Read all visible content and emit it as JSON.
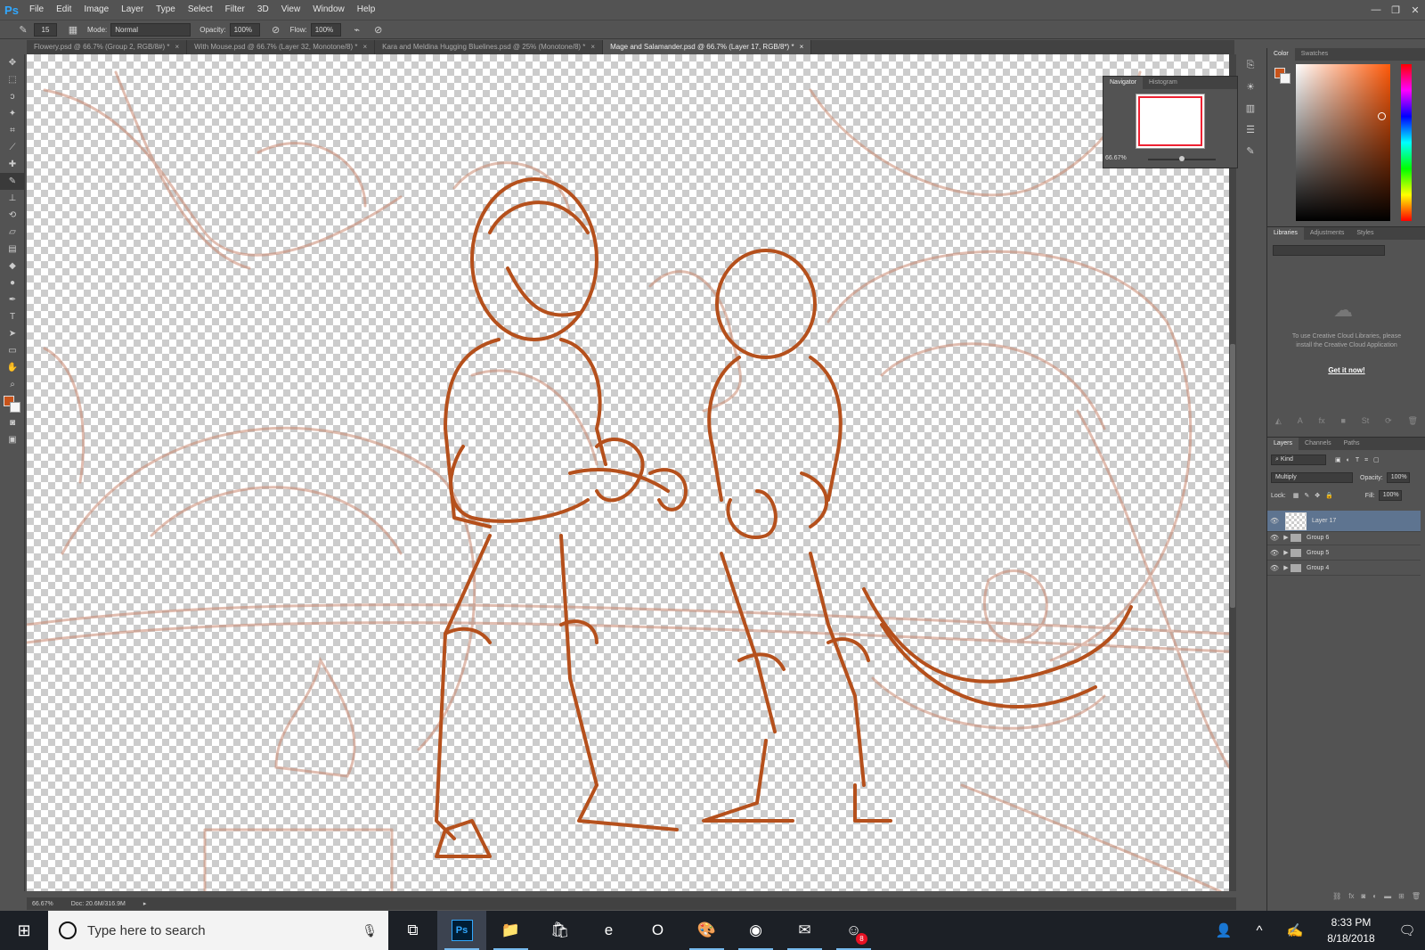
{
  "app": {
    "logo": "Ps"
  },
  "menu": [
    "File",
    "Edit",
    "Image",
    "Layer",
    "Type",
    "Select",
    "Filter",
    "3D",
    "View",
    "Window",
    "Help"
  ],
  "window_controls": {
    "minimize": "—",
    "restore": "❐",
    "close": "✕"
  },
  "options": {
    "brush_size": "15",
    "mode_label": "Mode:",
    "mode_value": "Normal",
    "opacity_label": "Opacity:",
    "opacity_value": "100%",
    "flow_label": "Flow:",
    "flow_value": "100%"
  },
  "tabs": [
    {
      "label": "Flowery.psd @ 66.7% (Group 2, RGB/8#) *",
      "close": "×"
    },
    {
      "label": "With Mouse.psd @ 66.7% (Layer 32, Monotone/8) *",
      "close": "×"
    },
    {
      "label": "Kara and Meldina Hugging Bluelines.psd @ 25% (Monotone/8) *",
      "close": "×"
    },
    {
      "label": "Mage and Salamander.psd @ 66.7% (Layer 17, RGB/8*) *",
      "close": "×"
    }
  ],
  "tools": [
    {
      "name": "move-tool-icon",
      "glyph": "✥"
    },
    {
      "name": "marquee-tool-icon",
      "glyph": "⬚"
    },
    {
      "name": "lasso-tool-icon",
      "glyph": "ↄ"
    },
    {
      "name": "magic-wand-icon",
      "glyph": "✦"
    },
    {
      "name": "crop-tool-icon",
      "glyph": "⌗"
    },
    {
      "name": "eyedropper-icon",
      "glyph": "⟋"
    },
    {
      "name": "healing-brush-icon",
      "glyph": "✚"
    },
    {
      "name": "brush-tool-icon",
      "glyph": "✎"
    },
    {
      "name": "stamp-tool-icon",
      "glyph": "⊥"
    },
    {
      "name": "history-brush-icon",
      "glyph": "⟲"
    },
    {
      "name": "eraser-icon",
      "glyph": "▱"
    },
    {
      "name": "gradient-tool-icon",
      "glyph": "▤"
    },
    {
      "name": "blur-tool-icon",
      "glyph": "◆"
    },
    {
      "name": "dodge-tool-icon",
      "glyph": "●"
    },
    {
      "name": "pen-tool-icon",
      "glyph": "✒"
    },
    {
      "name": "type-tool-icon",
      "glyph": "T"
    },
    {
      "name": "path-select-icon",
      "glyph": "➤"
    },
    {
      "name": "shape-tool-icon",
      "glyph": "▭"
    },
    {
      "name": "hand-tool-icon",
      "glyph": "✋"
    },
    {
      "name": "zoom-tool-icon",
      "glyph": "⌕"
    }
  ],
  "colors": {
    "foreground": "#c8531a",
    "background": "#f5f5f5",
    "sketch": "#b5501c",
    "underdrawing": "#c98870"
  },
  "navigator": {
    "tabs": [
      "Navigator",
      "Histogram"
    ],
    "zoom": "66.67%"
  },
  "color_panel": {
    "tabs": [
      "Color",
      "Swatches"
    ]
  },
  "libraries": {
    "tabs": [
      "Libraries",
      "Adjustments",
      "Styles"
    ],
    "message": "To use Creative Cloud Libraries, please install the Creative Cloud Application",
    "link": "Get it now!"
  },
  "layers_panel": {
    "tabs": [
      "Layers",
      "Channels",
      "Paths"
    ],
    "filter": "Kind",
    "blend": "Multiply",
    "opacity_label": "Opacity:",
    "opacity_value": "100%",
    "lock_label": "Lock:",
    "fill_label": "Fill:",
    "fill_value": "100%",
    "layers": [
      {
        "name": "Layer 17",
        "type": "layer",
        "selected": true
      },
      {
        "name": "Group 6",
        "type": "group",
        "selected": false
      },
      {
        "name": "Group 5",
        "type": "group",
        "selected": false
      },
      {
        "name": "Group 4",
        "type": "group",
        "selected": false
      }
    ]
  },
  "status": {
    "zoom": "66.67%",
    "doc": "Doc: 20.6M/316.9M"
  },
  "taskbar": {
    "search_placeholder": "Type here to search",
    "apps": [
      {
        "name": "task-view-icon",
        "glyph": "⧉"
      },
      {
        "name": "photoshop-icon",
        "glyph": "Ps"
      },
      {
        "name": "file-explorer-icon",
        "glyph": "📁"
      },
      {
        "name": "store-icon",
        "glyph": "🛍"
      },
      {
        "name": "edge-icon",
        "glyph": "e"
      },
      {
        "name": "opera-icon",
        "glyph": "O"
      },
      {
        "name": "paint-app-icon",
        "glyph": "🎨"
      },
      {
        "name": "chrome-icon",
        "glyph": "◉"
      },
      {
        "name": "mail-app-icon",
        "glyph": "✉"
      },
      {
        "name": "discord-icon",
        "glyph": "☺"
      }
    ],
    "badge": "8",
    "time": "8:33 PM",
    "date": "8/18/2018"
  }
}
